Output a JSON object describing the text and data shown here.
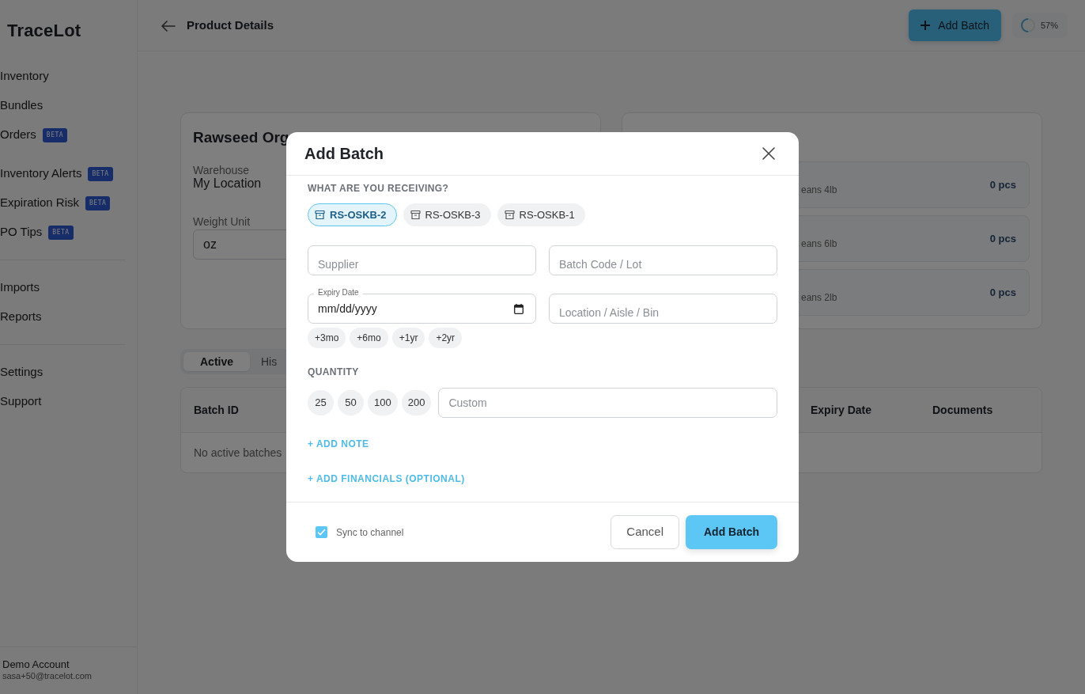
{
  "app": {
    "logo": "TraceLot"
  },
  "sidebar": {
    "sections": [
      {
        "divider_before": false,
        "items": [
          {
            "label": "Inventory"
          },
          {
            "label": "Bundles"
          },
          {
            "label": "Orders",
            "badge": "BETA"
          }
        ]
      },
      {
        "divider_before": false,
        "items": [
          {
            "label": "Inventory Alerts",
            "badge": "BETA"
          },
          {
            "label": "Expiration Risk",
            "badge": "BETA"
          },
          {
            "label": "PO Tips",
            "badge": "BETA"
          }
        ]
      },
      {
        "divider_before": true,
        "items": [
          {
            "label": "Imports"
          },
          {
            "label": "Reports"
          }
        ]
      },
      {
        "divider_before": true,
        "items": [
          {
            "label": "Settings"
          },
          {
            "label": "Support"
          }
        ]
      }
    ],
    "account": {
      "name": "Demo Account",
      "email": "sasa+50@tracelot.com"
    }
  },
  "header": {
    "title": "Product Details",
    "add_button": "Add Batch",
    "progress": {
      "reading": "57%"
    }
  },
  "product_card": {
    "title": "Rawseed Org",
    "fields": [
      {
        "kind": "text",
        "label": "Warehouse",
        "value": "My Location"
      },
      {
        "kind": "input",
        "label": "Weight Unit",
        "value": "oz"
      }
    ]
  },
  "variants": [
    {
      "name": "eans 4lb",
      "quantity": "0 pcs"
    },
    {
      "name": "eans 6lb",
      "quantity": "0 pcs"
    },
    {
      "name": "eans 2lb",
      "quantity": "0 pcs"
    }
  ],
  "batch_tabs": [
    {
      "label": "Active",
      "selected": true
    },
    {
      "label": "His",
      "selected": false
    }
  ],
  "batch_table": {
    "columns": [
      "Batch ID",
      "Expiry Date",
      "Documents"
    ],
    "empty_message": "No active batches"
  },
  "modal": {
    "title": "Add Batch",
    "receiving_label": "WHAT ARE YOU RECEIVING?",
    "items": [
      {
        "label": "RS-OSKB-2",
        "selected": true
      },
      {
        "label": "RS-OSKB-3",
        "selected": false
      },
      {
        "label": "RS-OSKB-1",
        "selected": false
      }
    ],
    "fields": [
      {
        "kind": "text",
        "placeholder": "Supplier"
      },
      {
        "kind": "text",
        "placeholder": "Batch Code / Lot"
      },
      {
        "kind": "date",
        "label": "Expiry Date",
        "placeholder": "mm/dd/yyyy"
      },
      {
        "kind": "text",
        "placeholder": "Location / Aisle / Bin"
      }
    ],
    "expiry_shortcuts": [
      "+3mo",
      "+6mo",
      "+1yr",
      "+2yr"
    ],
    "quantity_label": "QUANTITY",
    "quantity_presets": [
      "25",
      "50",
      "100",
      "200"
    ],
    "custom_quantity": {
      "placeholder": "Custom"
    },
    "links": [
      "+ ADD NOTE",
      "+ ADD FINANCIALS (OPTIONAL)"
    ],
    "sync": {
      "label": "Sync to channel",
      "checked": true
    },
    "cancel_button": "Cancel",
    "submit_button": "Add Batch"
  }
}
